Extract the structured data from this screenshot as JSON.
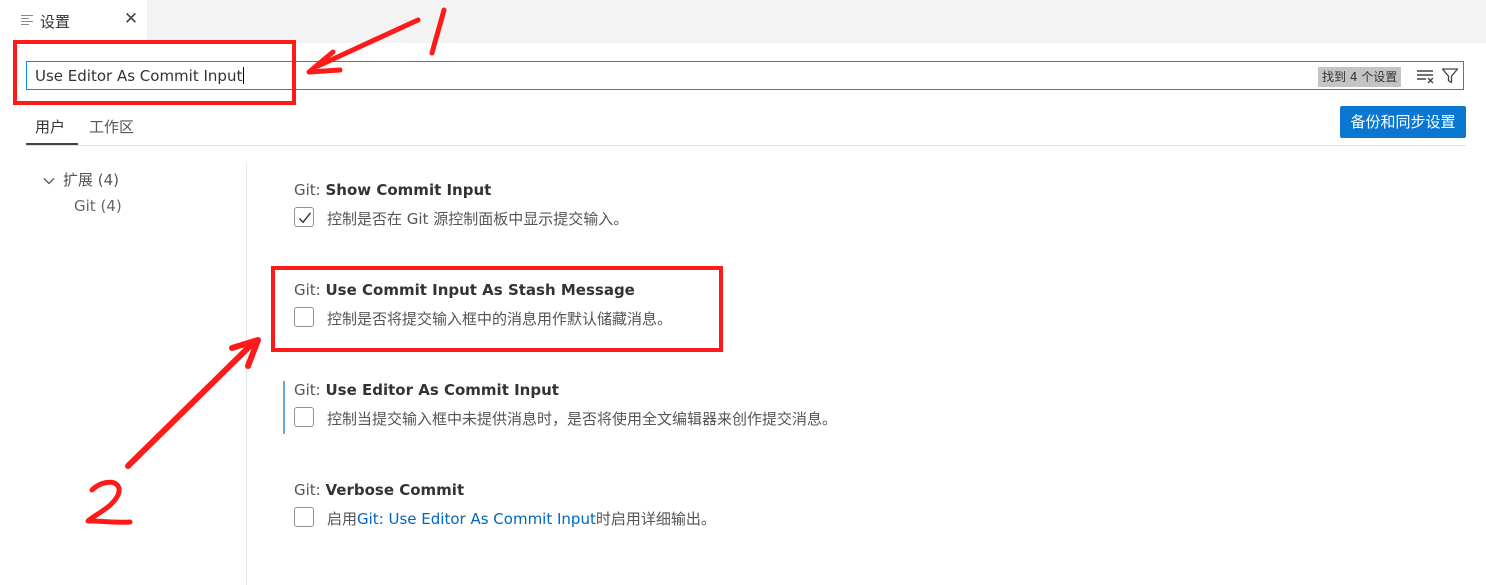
{
  "tab": {
    "title": "设置",
    "close_glyph": "✕"
  },
  "search": {
    "value": "Use Editor As Commit Input",
    "result_count": "找到 4 个设置"
  },
  "scopes": {
    "user": "用户",
    "workspace": "工作区"
  },
  "sync_button": "备份和同步设置",
  "toc": {
    "extensions": "扩展 (4)",
    "git": "Git (4)"
  },
  "settings": [
    {
      "category": "Git: ",
      "key": "Show Commit Input",
      "checked": true,
      "description": "控制是否在 Git 源控制面板中显示提交输入。"
    },
    {
      "category": "Git: ",
      "key": "Use Commit Input As Stash Message",
      "checked": false,
      "description": "控制是否将提交输入框中的消息用作默认储藏消息。"
    },
    {
      "category": "Git: ",
      "key": "Use Editor As Commit Input",
      "checked": false,
      "description": "控制当提交输入框中未提供消息时，是否将使用全文编辑器来创作提交消息。"
    },
    {
      "category": "Git: ",
      "key": "Verbose Commit",
      "checked": false,
      "description_prefix": "启用",
      "description_link": "Git: Use Editor As Commit Input",
      "description_suffix": "时启用详细输出。"
    }
  ],
  "annotations": {
    "color": "#ff1a1a"
  },
  "colors": {
    "accent": "#0a78d3",
    "focus_border": "#0090f1",
    "link": "#0066bf"
  }
}
